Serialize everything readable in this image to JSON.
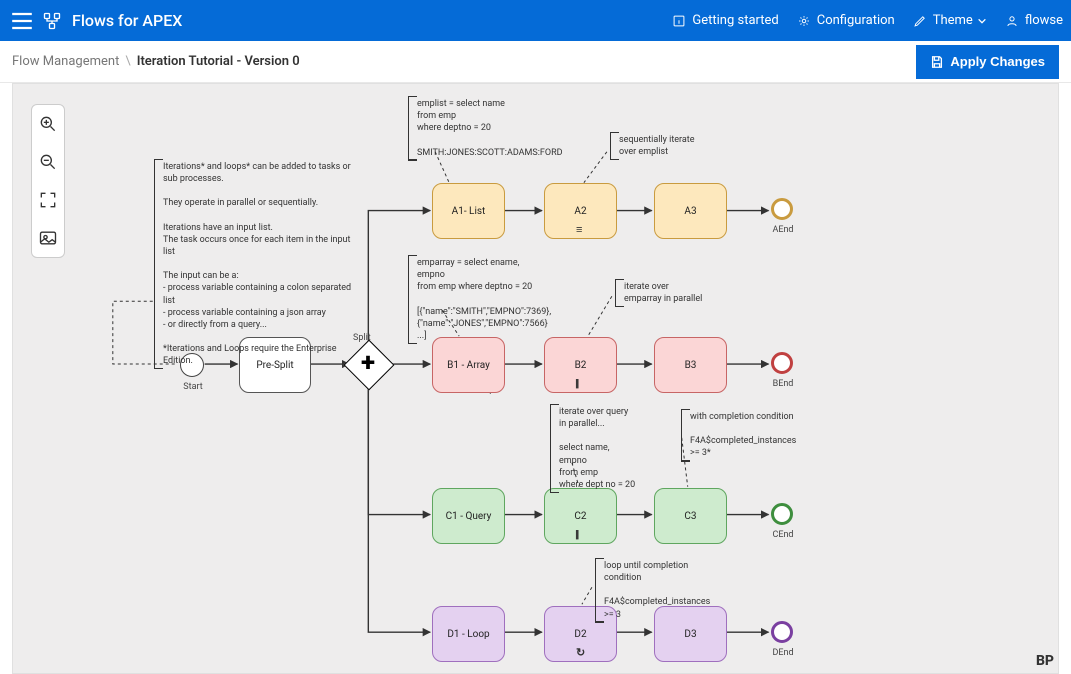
{
  "header": {
    "app_title": "Flows for APEX",
    "links": {
      "getting_started": "Getting started",
      "configuration": "Configuration",
      "theme": "Theme",
      "user": "flowse"
    }
  },
  "breadcrumb": {
    "root": "Flow Management",
    "leaf": "Iteration Tutorial - Version 0"
  },
  "actions": {
    "apply_changes": "Apply Changes"
  },
  "diagram": {
    "start_label": "Start",
    "gateway_label": "Split",
    "pre_split": "Pre-Split",
    "rows": {
      "a": {
        "tasks": [
          "A1- List",
          "A2",
          "A3"
        ],
        "end": "AEnd",
        "marker": "≡"
      },
      "b": {
        "tasks": [
          "B1 - Array",
          "B2",
          "B3"
        ],
        "end": "BEnd",
        "marker": "|||"
      },
      "c": {
        "tasks": [
          "C1 - Query",
          "C2",
          "C3"
        ],
        "end": "CEnd",
        "marker": "|||"
      },
      "d": {
        "tasks": [
          "D1 - Loop",
          "D2",
          "D3"
        ],
        "end": "DEnd",
        "marker": "↻"
      }
    },
    "annotations": {
      "main": "Iterations* and loops* can be added to tasks or sub processes.\n\nThey operate in parallel or sequentially.\n\nIterations have an input list.\nThe task occurs once for each item in the input list\n\nThe input can be a:\n- process variable containing a colon separated list\n- process variable containing a json array\n- or directly from a query...\n\n*Iterations and Loops require the Enterprise Edition.",
      "a_list": "emplist = select name\nfrom emp\nwhere deptno = 20\n\nSMITH:JONES:SCOTT:ADAMS:FORD",
      "a_seq": "sequentially iterate over emplist",
      "b_array": "emparray = select ename, empno\nfrom emp where deptno = 20\n\n[{\"name\":\"SMITH\",\"EMPNO\":7369},\n{\"name\":\"JONES\",\"EMPNO\":7566}\n...]",
      "b_par": "iterate over emparray in parallel",
      "c_query": "iterate over query in parallel...\n\nselect name, empno\nfrom emp\nwhere dept no = 20",
      "c_cond": "with completion condition\n\nF4A$completed_instances >= 3*",
      "d_loop": "loop until completion condition\n\nF4A$completed_instances >= 3"
    }
  },
  "bp_logo": "BP"
}
